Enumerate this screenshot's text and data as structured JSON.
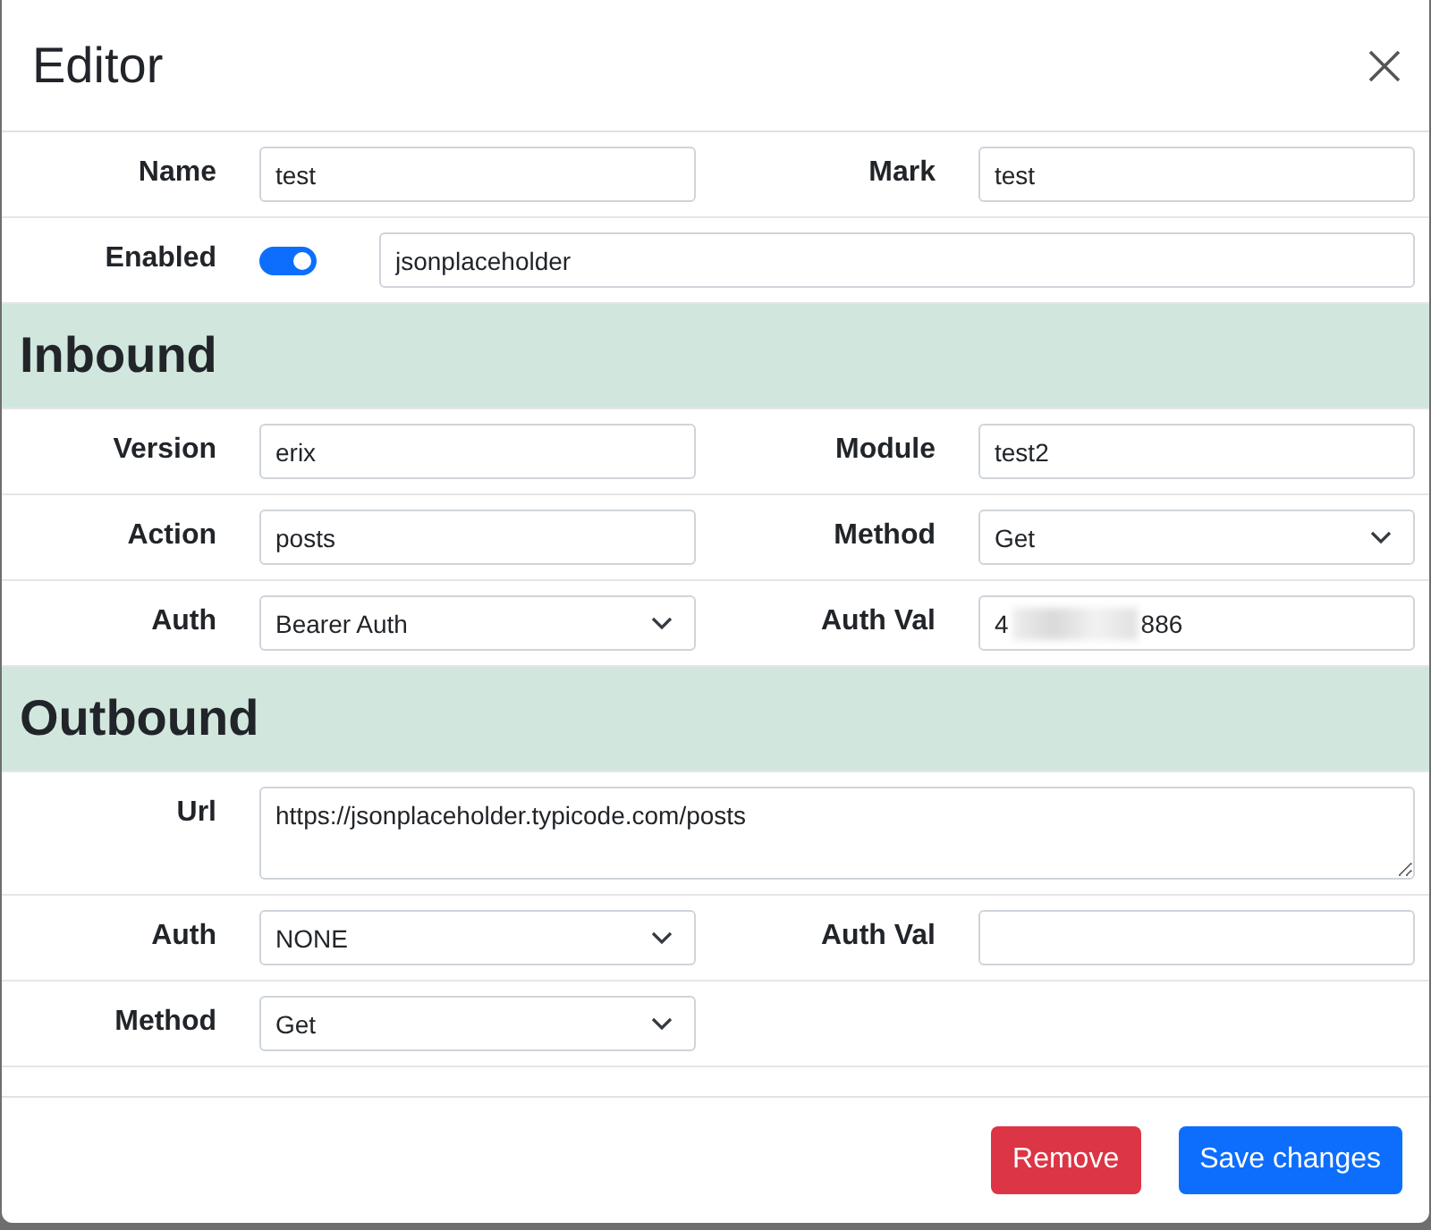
{
  "dialog": {
    "title": "Editor"
  },
  "general": [
    {
      "fields": [
        {
          "label": "Name",
          "kind": "text",
          "value": "test"
        },
        {
          "label": "Mark",
          "kind": "text",
          "value": "test"
        }
      ]
    },
    {
      "fields": [
        {
          "label": "Enabled",
          "kind": "switch",
          "on": true,
          "value": "jsonplaceholder"
        }
      ]
    }
  ],
  "sections": [
    {
      "title": "Inbound",
      "rows": [
        {
          "fields": [
            {
              "label": "Version",
              "kind": "text",
              "value": "erix"
            },
            {
              "label": "Module",
              "kind": "text",
              "value": "test2"
            }
          ]
        },
        {
          "fields": [
            {
              "label": "Action",
              "kind": "text",
              "value": "posts"
            },
            {
              "label": "Method",
              "kind": "select",
              "value": "Get"
            }
          ]
        },
        {
          "fields": [
            {
              "label": "Auth",
              "kind": "select",
              "value": "Bearer Auth"
            },
            {
              "label": "Auth Val",
              "kind": "masked",
              "value_start": "4",
              "value_end": "886"
            }
          ]
        }
      ]
    },
    {
      "title": "Outbound",
      "rows": [
        {
          "fields": [
            {
              "label": "Url",
              "kind": "textarea",
              "value": "https://jsonplaceholder.typicode.com/posts"
            }
          ]
        },
        {
          "fields": [
            {
              "label": "Auth",
              "kind": "select",
              "value": "NONE"
            },
            {
              "label": "Auth Val",
              "kind": "text"
            }
          ]
        },
        {
          "fields": [
            {
              "label": "Method",
              "kind": "select",
              "value": "Get"
            }
          ]
        }
      ]
    }
  ],
  "buttons": [
    {
      "label": "Remove",
      "kind": "danger"
    },
    {
      "label": "Save changes",
      "kind": "primary"
    }
  ]
}
